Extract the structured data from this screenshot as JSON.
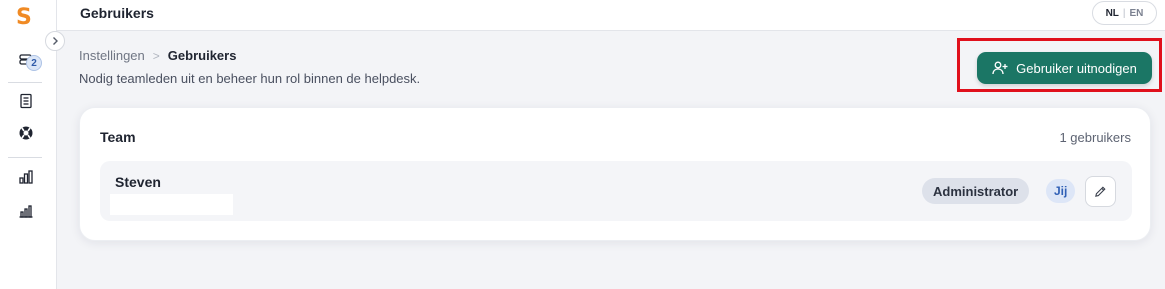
{
  "app": {
    "logo_letter": "S"
  },
  "sidebar": {
    "badge_count": "2",
    "icons": [
      "chat-stack-icon",
      "ticket-list-icon",
      "support-lifebuoy-icon",
      "building-stats-icon",
      "bar-chart-icon"
    ]
  },
  "topbar": {
    "title": "Gebruikers",
    "lang": {
      "active": "NL",
      "separator": "|",
      "other": "EN"
    }
  },
  "header": {
    "breadcrumb": {
      "parent": "Instellingen",
      "separator": ">",
      "current": "Gebruikers"
    },
    "subtitle": "Nodig teamleden uit en beheer hun rol binnen de helpdesk.",
    "invite_button": "Gebruiker uitnodigen"
  },
  "team": {
    "title": "Team",
    "count": "1 gebruikers",
    "users": [
      {
        "name": "Steven",
        "role": "Administrator",
        "you_badge": "Jij"
      }
    ]
  },
  "colors": {
    "accent": "#1b7665",
    "logo": "#f08a24",
    "highlight_outline": "#e0101c"
  }
}
